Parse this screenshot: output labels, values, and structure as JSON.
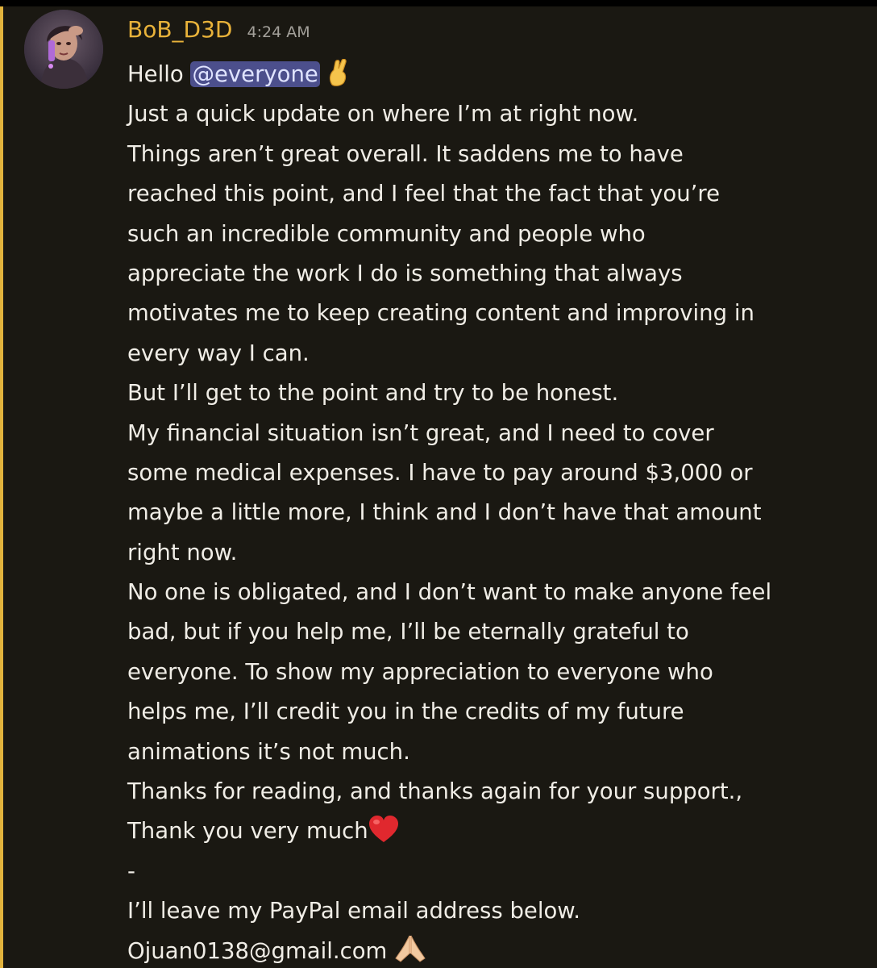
{
  "message": {
    "author": {
      "username": "BoB_D3D",
      "timestamp": "4:24 AM",
      "avatar_icon": "avatar-icon"
    },
    "greeting": {
      "prefix": "Hello ",
      "mention": "@everyone",
      "emoji": "crossed-fingers-icon"
    },
    "lines": [
      "Just a quick update on where I’m at right now.",
      "Things aren’t great overall. It saddens me to have",
      "reached this point, and I feel that the fact that you’re",
      "such an incredible community and people who",
      "appreciate the work I do is something that always",
      "motivates me to keep creating content and improving in",
      "every way I can.",
      "But I’ll get to the point and try to be honest.",
      "My financial situation isn’t great, and I need to cover",
      "some medical expenses. I have to pay around $3,000 or",
      "maybe a little more, I think and I don’t have that amount",
      "right now.",
      "No one is obligated, and I don’t want to make anyone feel",
      "bad, but if you help me, I’ll be eternally grateful to",
      "everyone. To show my appreciation to everyone who",
      "helps me, I’ll credit you in the credits of my future",
      "animations it’s not much.",
      "Thanks for reading, and thanks again for your support.,"
    ],
    "thank_you": {
      "text": "Thank you very much",
      "emoji": "red-heart-icon"
    },
    "separator": "-",
    "paypal_line": "I’ll leave my PayPal email address below.",
    "email": {
      "text": "Ojuan0138@gmail.com",
      "emoji": "folded-hands-icon"
    }
  },
  "colors": {
    "background": "#1a1812",
    "username": "#e8b23a",
    "timestamp": "#a3a09a",
    "text": "#f0ede6",
    "mention_bg": "#4c4f8c",
    "highlight_bar": "#e2b33d"
  }
}
